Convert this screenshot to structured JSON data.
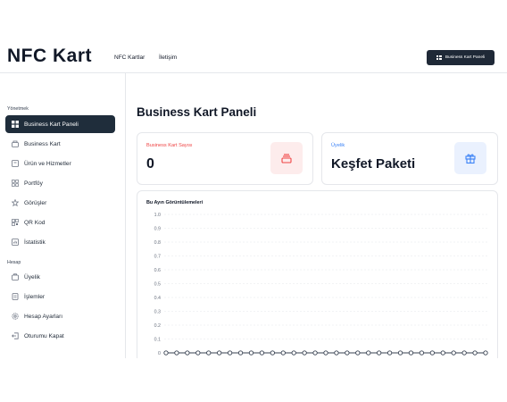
{
  "header": {
    "logo": "NFC Kart",
    "nav": [
      "NFC Kartlar",
      "İletişim"
    ],
    "button_label": "Business Kart Paneli"
  },
  "sidebar": {
    "section1_title": "Yönetmek",
    "section1_items": [
      {
        "label": "Business Kart Paneli",
        "icon": "dashboard-icon",
        "active": true
      },
      {
        "label": "Business Kart",
        "icon": "card-icon"
      },
      {
        "label": "Ürün ve Hizmetler",
        "icon": "box-icon"
      },
      {
        "label": "Portföy",
        "icon": "grid-icon"
      },
      {
        "label": "Görüşler",
        "icon": "star-icon"
      },
      {
        "label": "QR Kod",
        "icon": "qr-icon"
      },
      {
        "label": "İstatistik",
        "icon": "chart-icon"
      }
    ],
    "section2_title": "Hesap",
    "section2_items": [
      {
        "label": "Üyelik",
        "icon": "membership-icon"
      },
      {
        "label": "İşlemler",
        "icon": "transactions-icon"
      },
      {
        "label": "Hesap Ayarları",
        "icon": "settings-icon"
      },
      {
        "label": "Oturumu Kapat",
        "icon": "logout-icon"
      }
    ]
  },
  "main": {
    "title": "Business Kart Paneli",
    "card1": {
      "label": "Business Kart Sayısı",
      "value": "0",
      "icon": "stack-icon"
    },
    "card2": {
      "label": "Üyelik",
      "value": "Keşfet Paketi",
      "icon": "gift-icon"
    }
  },
  "colors": {
    "sidebar_active": "#1f2d3b",
    "card1_label": "#ef4444",
    "card1_icon_bg": "#fdecec",
    "card2_label": "#3b82f6",
    "card2_icon_bg": "#eaf1fe",
    "line": "#374151"
  },
  "chart_data": {
    "type": "line",
    "title": "Bu Ayın Görüntülemeleri",
    "y_ticks": [
      "1.0",
      "0.9",
      "0.8",
      "0.7",
      "0.6",
      "0.5",
      "0.4",
      "0.3",
      "0.2",
      "0.1",
      "0"
    ],
    "ylim": [
      0,
      1.0
    ],
    "grid": true,
    "series": [
      {
        "values": [
          0,
          0,
          0,
          0,
          0,
          0,
          0,
          0,
          0,
          0,
          0,
          0,
          0,
          0,
          0,
          0,
          0,
          0,
          0,
          0,
          0,
          0,
          0,
          0,
          0,
          0,
          0,
          0,
          0,
          0,
          0
        ]
      }
    ]
  }
}
